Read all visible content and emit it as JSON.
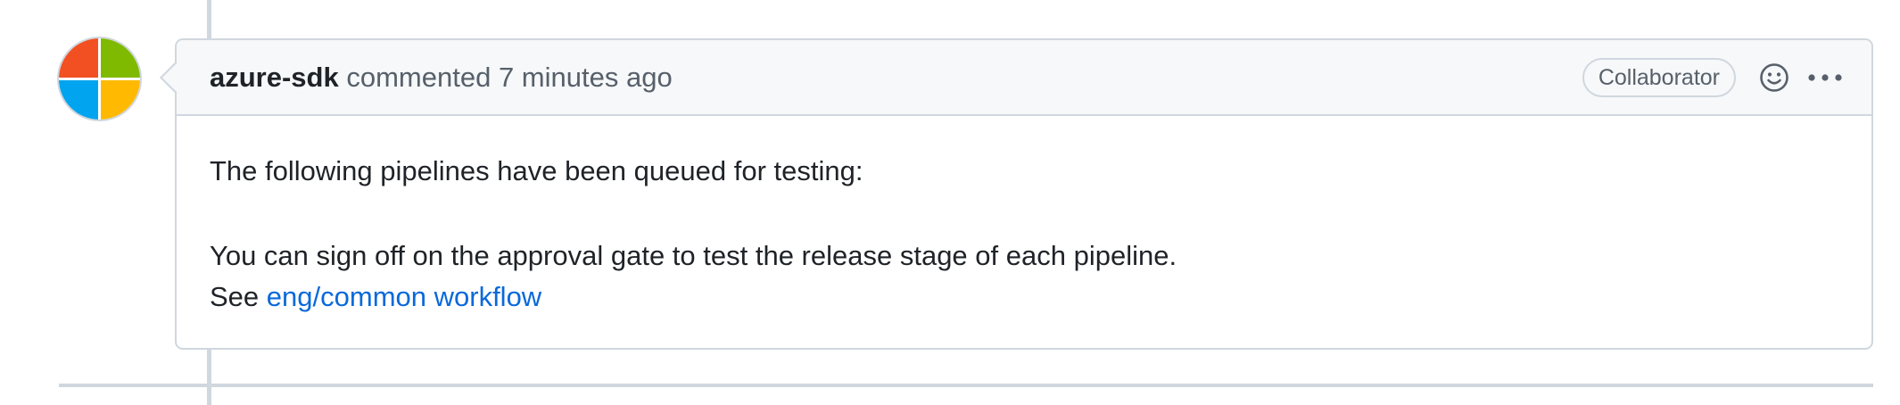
{
  "comment": {
    "author": "azure-sdk",
    "action": "commented",
    "time": "7 minutes ago",
    "role_badge": "Collaborator",
    "body_line1": "The following pipelines have been queued for testing:",
    "body_line2": "You can sign off on the approval gate to test the release stage of each pipeline.",
    "see_prefix": "See",
    "link_text": "eng/common workflow"
  },
  "icons": {
    "avatar": "microsoft-logo-avatar",
    "reaction": "smiley-icon",
    "menu": "kebab-menu-icon"
  },
  "colors": {
    "logo_red": "#f25022",
    "logo_green": "#7fba00",
    "logo_blue": "#00a4ef",
    "logo_yellow": "#ffb900",
    "link": "#0969da",
    "border": "#d0d7de",
    "header_bg": "#f6f8fa"
  }
}
